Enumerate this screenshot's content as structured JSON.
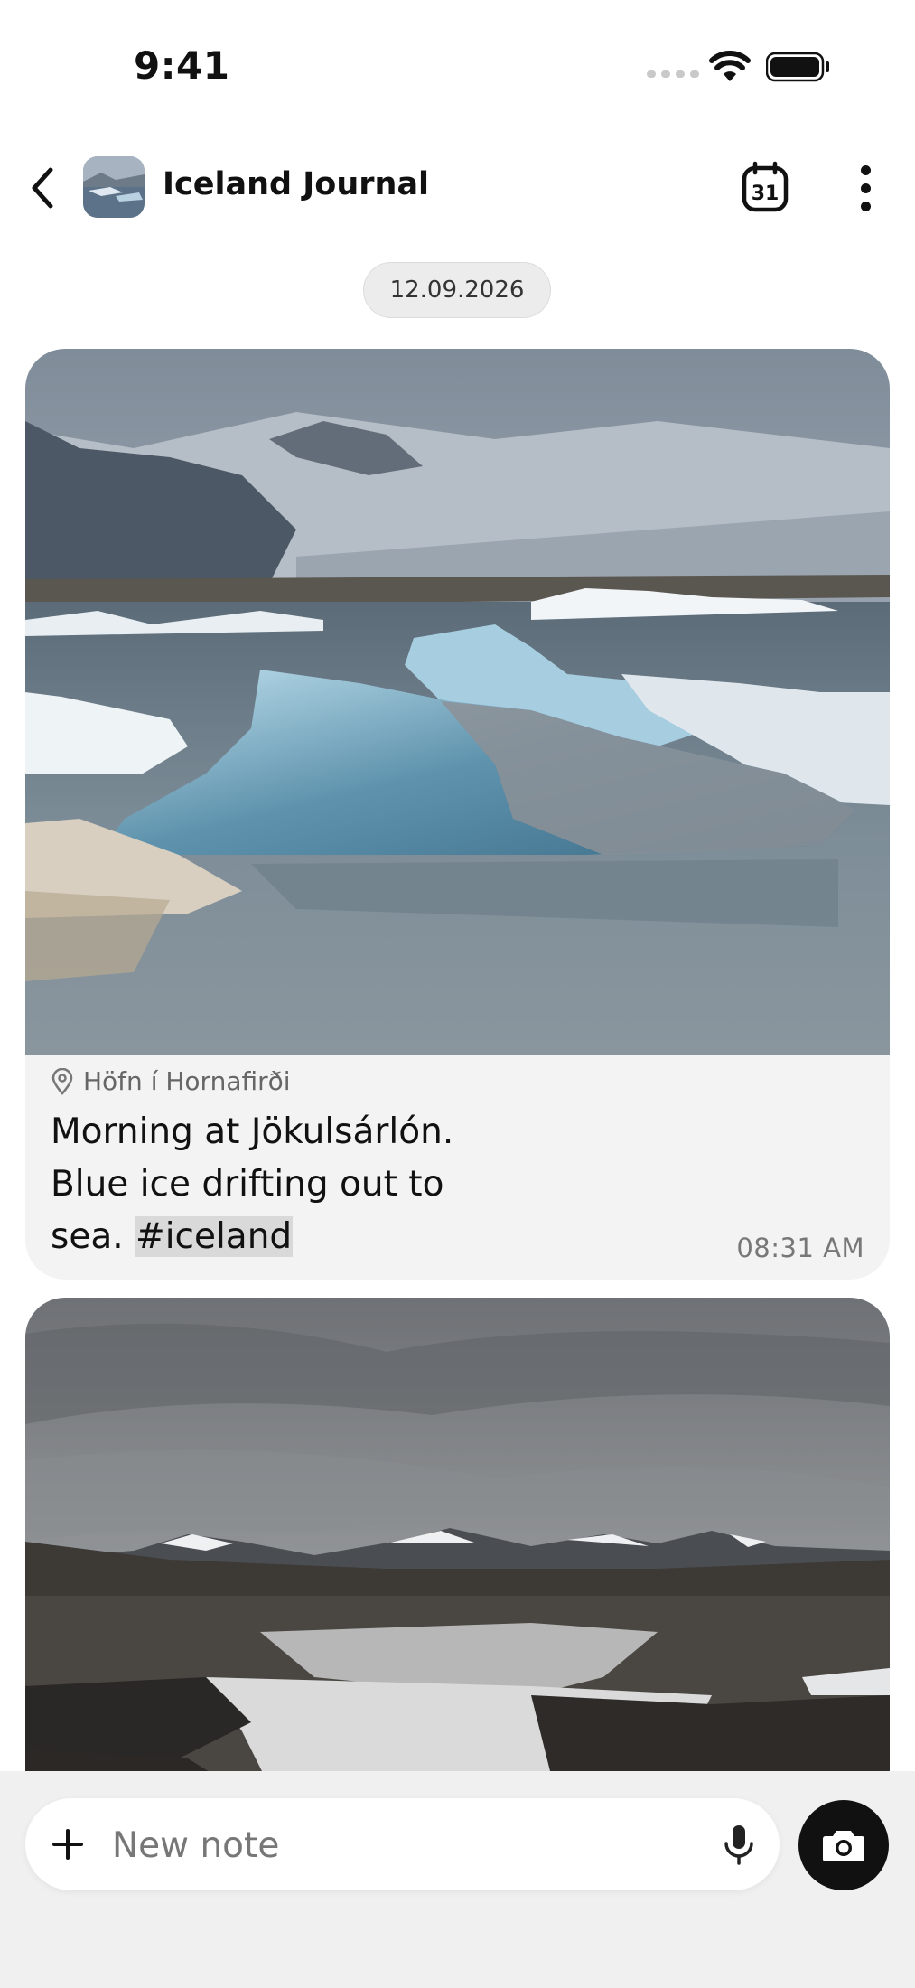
{
  "status_bar": {
    "time": "9:41",
    "icons": [
      "cellular-signal-icon",
      "wifi-icon",
      "battery-icon"
    ]
  },
  "header": {
    "title": "Iceland Journal",
    "back_icon": "chevron-left-icon",
    "calendar_icon_text": "31",
    "more_icon": "vertical-ellipsis-icon"
  },
  "date_chip": "12.09.2026",
  "entries": [
    {
      "photo": "glacier-lagoon-icebergs-photo",
      "location": "Höfn í Hornafirði",
      "text_lines": [
        "Morning at Jökulsárlón.",
        "Blue ice drifting out to",
        "sea. "
      ],
      "hashtag": "#iceland",
      "time": "08:31 AM"
    },
    {
      "photo": "highland-waterfall-river-photo"
    }
  ],
  "composer": {
    "placeholder": "New note",
    "add_icon": "plus-icon",
    "mic_icon": "microphone-icon",
    "camera_icon": "camera-icon"
  },
  "colors": {
    "background": "#ffffff",
    "card_background": "#f3f3f3",
    "composer_background": "#f0f0f0",
    "hashtag_highlight": "#d9d9d9",
    "camera_button": "#111111"
  }
}
